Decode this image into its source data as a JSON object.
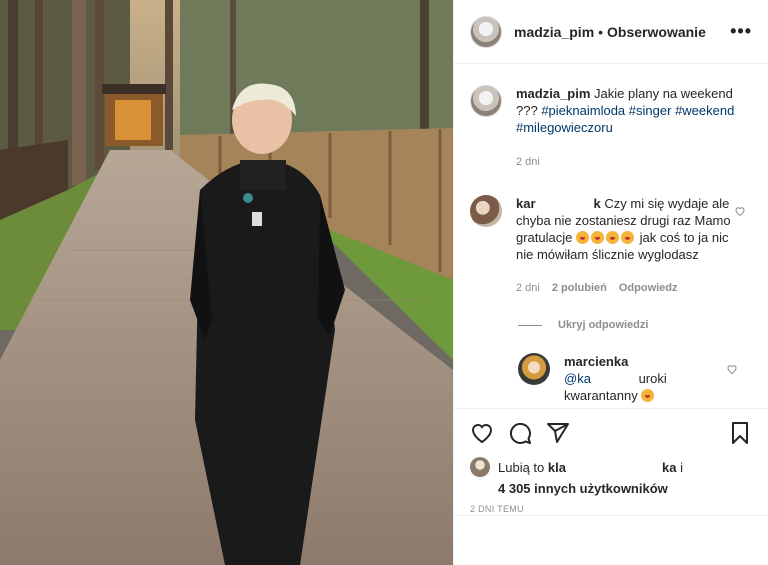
{
  "post": {
    "username": "madzia_pim",
    "dot": "•",
    "follow_label": "Obserwowanie",
    "more_icon": "more-icon",
    "caption_text": "Jakie plany na weekend ???",
    "hashtags": [
      "#pieknaimloda",
      "#singer",
      "#weekend",
      "#milegowieczoru"
    ],
    "caption_time": "2 dni"
  },
  "comments": [
    {
      "username": "kar",
      "username_tail": "k",
      "text": "Czy mi się wydaje ale chyba nie zostaniesz drugi raz Mamo gratulacje",
      "text_after": "jak coś to ja nic nie mówiłam ślicznie wyglodasz",
      "time": "2 dni",
      "likes": "2 polubień",
      "reply_label": "Odpowiedz",
      "hide_replies": "Ukryj odpowiedzi"
    }
  ],
  "replies": [
    {
      "username": "marcienka",
      "mention": "@ka",
      "text": "uroki kwarantanny"
    }
  ],
  "likes": {
    "prefix": "Lubią to",
    "user_start": "kla",
    "user_end": "ka",
    "trailing": "i",
    "count_text": "4 305 innych użytkowników"
  },
  "time_ago": "2 DNI TEMU",
  "colors": {
    "link": "#00376b",
    "muted": "#8e8e8e",
    "text": "#262626",
    "border": "#efefef"
  }
}
